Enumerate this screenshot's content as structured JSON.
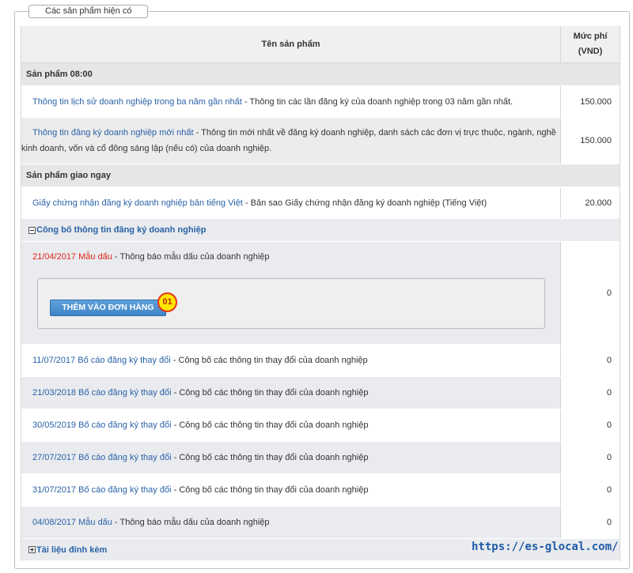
{
  "panel": {
    "legend": "Các sản phẩm hiện có"
  },
  "header": {
    "name_col": "Tên sản phẩm",
    "price_col_line1": "Mức phí",
    "price_col_line2": "(VND)"
  },
  "groups": [
    {
      "title": "Sản phẩm 08:00",
      "items": [
        {
          "link": "Thông tin lịch sử doanh nghiệp trong ba năm gần nhất",
          "desc": "- Thông tin các lần đăng ký của doanh nghiệp trong 03 năm gần nhất.",
          "price": "150.000"
        },
        {
          "link": "Thông tin đăng ký doanh nghiệp mới nhất",
          "desc": "- Thông tin mới nhất về đăng ký doanh nghiệp, danh sách các đơn vị trực thuộc, ngành, nghề",
          "desc2": "kinh doanh, vốn và cổ đông sáng lập (nếu có) của doanh nghiệp.",
          "price": "150.000"
        }
      ]
    },
    {
      "title": "Sản phẩm giao ngay",
      "items": [
        {
          "link": "Giấy chứng nhận đăng ký doanh nghiệp bản tiếng Việt",
          "desc": "- Bản sao Giấy chứng nhận đăng ký doanh nghiệp (Tiếng Việt)",
          "price": "20.000"
        }
      ]
    }
  ],
  "announcements": {
    "title": "Công bố thông tin đăng ký doanh nghiệp",
    "selected": {
      "link": "21/04/2017 Mẫu dấu",
      "desc": "- Thông báo mẫu dấu của doanh nghiệp",
      "price": "0",
      "button": "THÊM VÀO ĐƠN HÀNG",
      "badge": "01"
    },
    "items": [
      {
        "link": "11/07/2017 Bố cáo đăng ký thay đổi",
        "desc": "- Công bố các thông tin thay đổi của doanh nghiệp",
        "price": "0"
      },
      {
        "link": "21/03/2018 Bố cáo đăng ký thay đổi",
        "desc": "- Công bố các thông tin thay đổi của doanh nghiệp",
        "price": "0"
      },
      {
        "link": "30/05/2019 Bố cáo đăng ký thay đổi",
        "desc": "- Công bố các thông tin thay đổi của doanh nghiệp",
        "price": "0"
      },
      {
        "link": "27/07/2017 Bố cáo đăng ký thay đổi",
        "desc": "- Công bố các thông tin thay đổi của doanh nghiệp",
        "price": "0"
      },
      {
        "link": "31/07/2017 Bố cáo đăng ký thay đổi",
        "desc": "- Công bố các thông tin thay đổi của doanh nghiệp",
        "price": "0"
      },
      {
        "link": "04/08/2017 Mẫu dấu",
        "desc": "- Thông báo mẫu dấu của doanh nghiệp",
        "price": "0"
      }
    ]
  },
  "attachments": {
    "title": "Tài liệu đính kèm"
  },
  "watermark": {
    "text_line1": "ES",
    "text_line2": "GLOCAL",
    "url": "https://es-glocal.com/"
  },
  "colors": {
    "link": "#2a62a8",
    "selected_link": "#e2231a",
    "button": "#3f85c7",
    "badge": "#ffe800"
  },
  "icons": {
    "collapse": "minus-box-icon",
    "expand": "plus-box-icon"
  }
}
